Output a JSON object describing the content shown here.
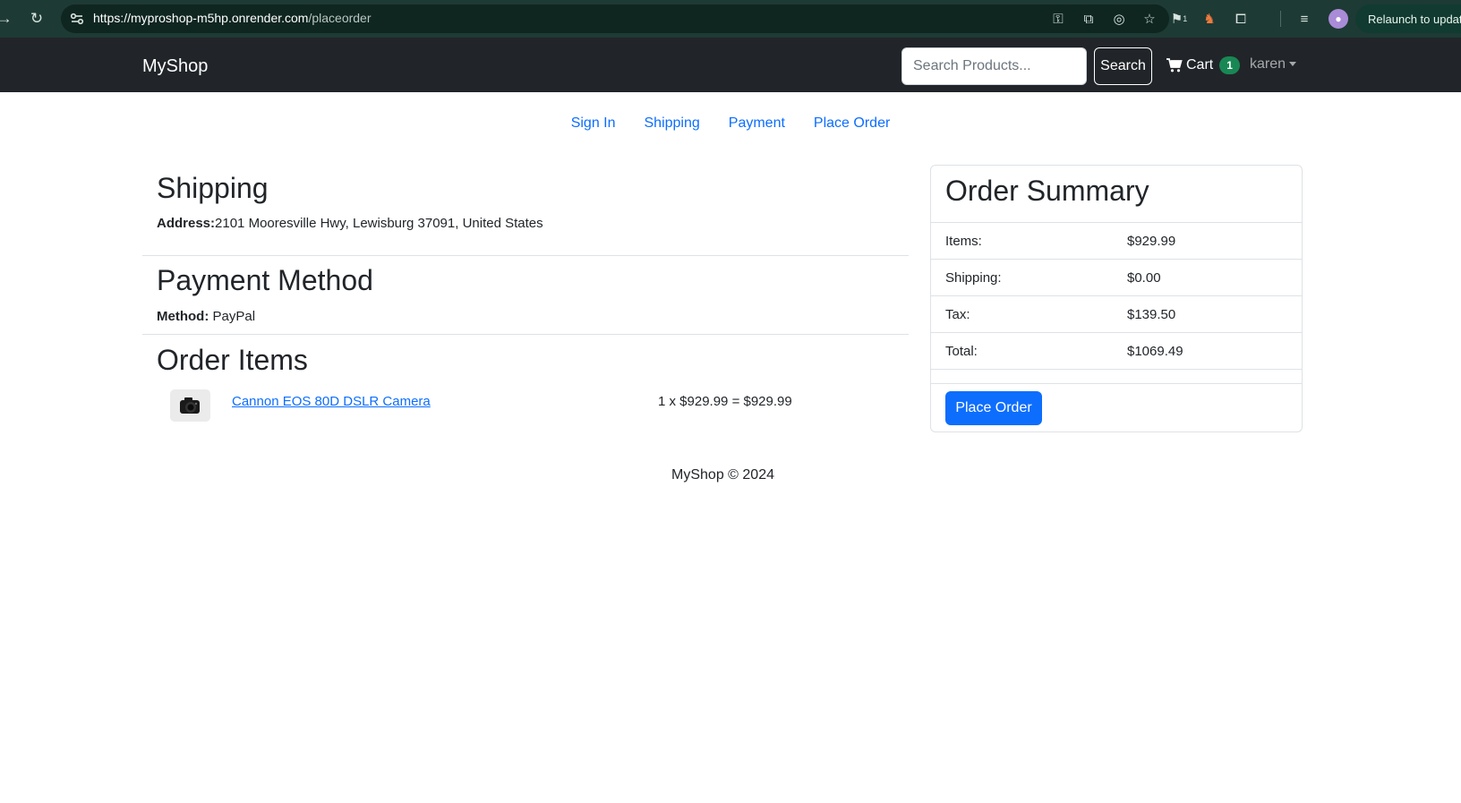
{
  "browser": {
    "url_host": "https://myproshop-m5hp.onrender.com",
    "url_path": "/placeorder",
    "relaunch_label": "Relaunch to update",
    "extension_badge": "1"
  },
  "navbar": {
    "brand": "MyShop",
    "search_placeholder": "Search Products...",
    "search_button": "Search",
    "cart_label": "Cart",
    "cart_count": "1",
    "user_name": "karen"
  },
  "steps": [
    "Sign In",
    "Shipping",
    "Payment",
    "Place Order"
  ],
  "shipping": {
    "heading": "Shipping",
    "address_label": "Address:",
    "address_value": "2101 Mooresville Hwy, Lewisburg 37091, United States"
  },
  "payment": {
    "heading": "Payment Method",
    "method_label": "Method:",
    "method_value": "PayPal"
  },
  "order_items": {
    "heading": "Order Items",
    "items": [
      {
        "name": "Cannon EOS 80D DSLR Camera",
        "price_line": "1 x $929.99 = $929.99"
      }
    ]
  },
  "summary": {
    "title": "Order Summary",
    "rows": [
      {
        "label": "Items:",
        "value": "$929.99"
      },
      {
        "label": "Shipping:",
        "value": "$0.00"
      },
      {
        "label": "Tax:",
        "value": "$139.50"
      },
      {
        "label": "Total:",
        "value": "$1069.49"
      }
    ],
    "button": "Place Order"
  },
  "footer": "MyShop © 2024",
  "colors": {
    "accent": "#0d6efd",
    "navbar": "#212529",
    "badge": "#198754"
  }
}
